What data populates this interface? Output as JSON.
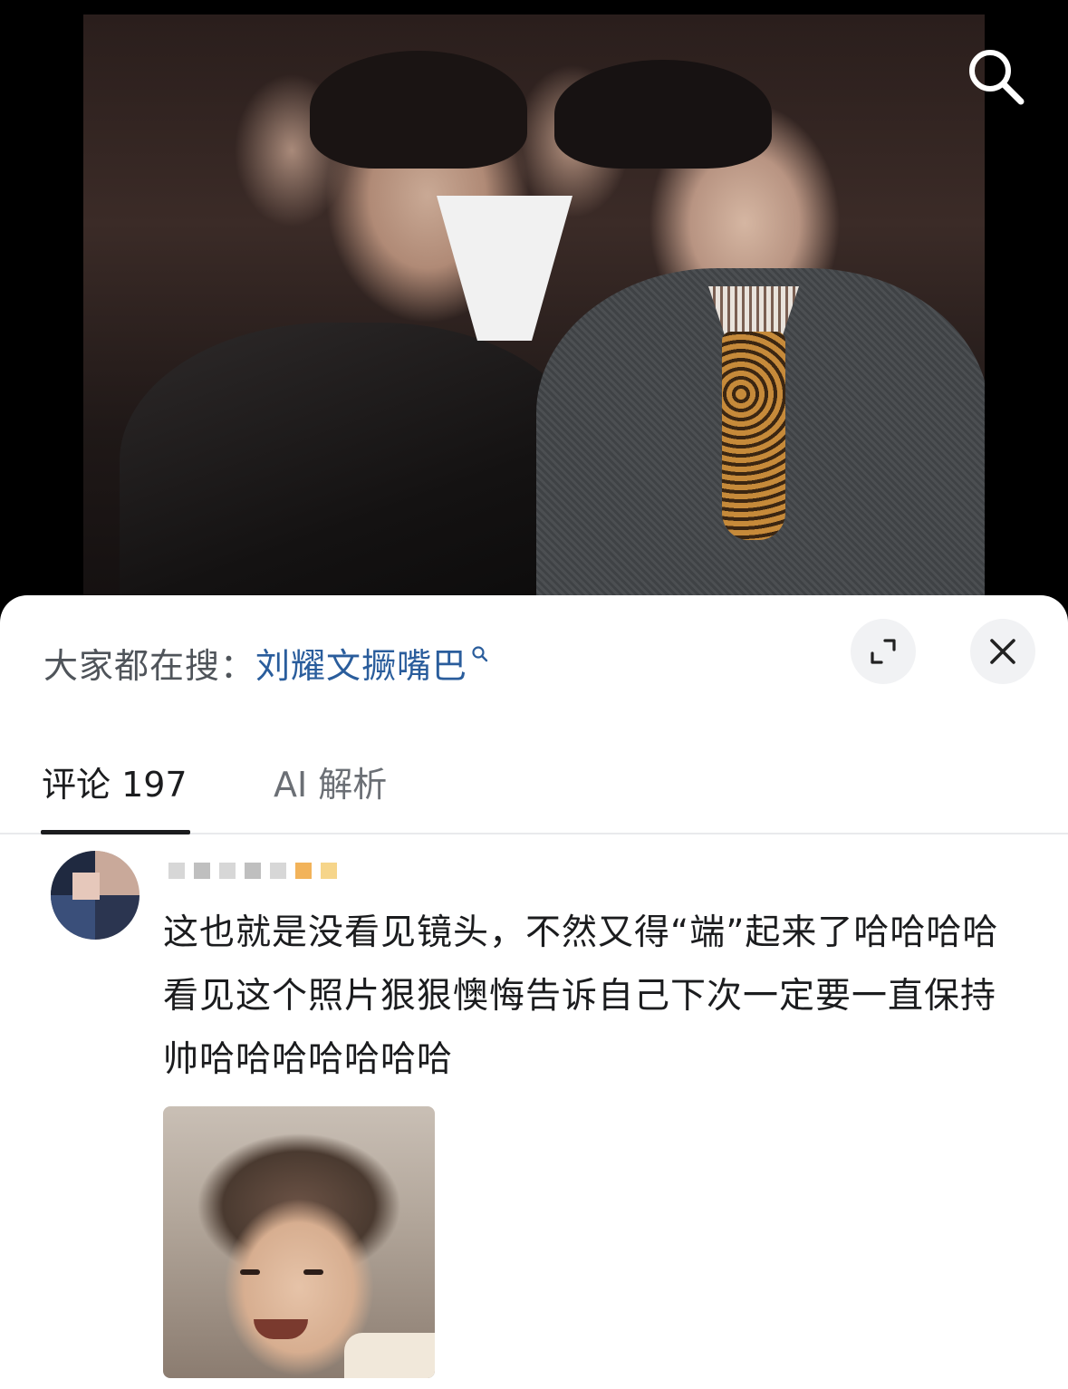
{
  "media": {
    "search_icon": "search-icon"
  },
  "sheet": {
    "hot_search": {
      "label": "大家都在搜：",
      "keyword": "刘耀文撅嘴巴",
      "icon": "search-icon"
    },
    "expand_icon": "expand-icon",
    "close_icon": "close-icon",
    "tabs": [
      {
        "label": "评论 197",
        "active": true
      },
      {
        "label": "AI 解析",
        "active": false
      }
    ]
  },
  "comment": {
    "text": "这也就是没看见镜头，不然又得“端”起来了哈哈哈哈看见这个照片狠狠懊悔告诉自己下次一定要一直保持帅哈哈哈哈哈哈哈"
  },
  "colors": {
    "keyword": "#2a5d9c",
    "tab_active": "#1b1c1e",
    "tab_inactive": "#6b6f75"
  }
}
